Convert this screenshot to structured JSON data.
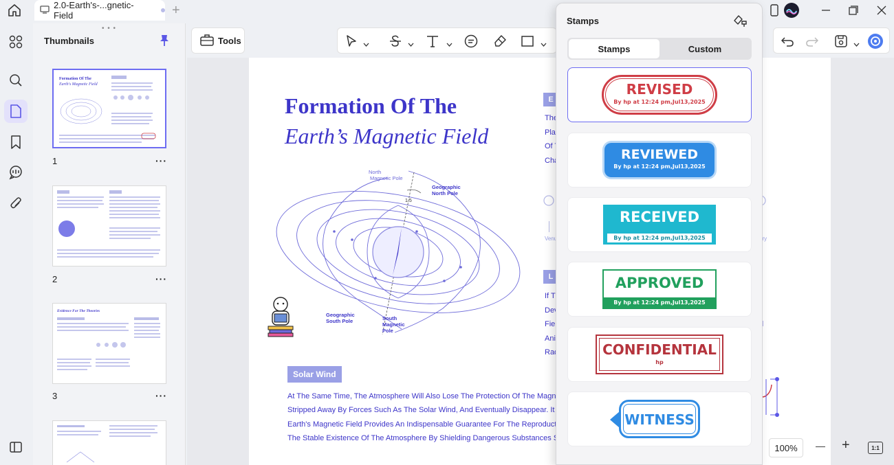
{
  "titlebar": {
    "tab_title": "2.0-Earth's-...gnetic-Field",
    "new_tab": "+"
  },
  "thumbnails": {
    "title": "Thumbnails",
    "pages": [
      {
        "number": "1",
        "more": "···"
      },
      {
        "number": "2",
        "more": "···"
      },
      {
        "number": "3",
        "more": "···"
      }
    ]
  },
  "toolbar": {
    "tools_label": "Tools"
  },
  "document": {
    "title_line1": "Formation Of The",
    "title_line2": "Earth’s Magnetic Field",
    "diagram": {
      "north_magnetic": [
        "North",
        "Magnetic Pole"
      ],
      "geo_north": [
        "Geographic",
        "North Pole"
      ],
      "angle": "1.5",
      "geo_south": [
        "Geographic",
        "South Pole"
      ],
      "south_magnetic": [
        "South",
        "Magnetic",
        "Pole"
      ]
    },
    "solar_wind_badge": "Solar Wind",
    "body_lines": [
      "At The Same Time, The Atmosphere Will Also Lose The Protection Of The Magnetic Field A",
      "Stripped Away By Forces Such As The Solar Wind, And Eventually Disappear. It Can Be Sa",
      "Earth's Magnetic Field Provides An Indispensable Guarantee For The Reproduction Of Life O",
      "The Stable Existence Of The Atmosphere By Shielding Dangerous Substances Such As Sol"
    ],
    "side_badge1": "E",
    "side_lines1": [
      "The",
      "Play",
      "Of T",
      "Cha"
    ],
    "side_label_left": "Venu",
    "side_label_right": "ury",
    "side_badge2": "L",
    "side_lines2": [
      "If T",
      "Dev",
      "Fiel",
      "Ani",
      "Rad"
    ],
    "right_peek": [
      "z",
      "d"
    ]
  },
  "zoom": {
    "value": "100%",
    "minus": "—",
    "plus": "+",
    "fit": "1:1"
  },
  "stamps_panel": {
    "title": "Stamps",
    "tabs": {
      "stamps": "Stamps",
      "custom": "Custom"
    },
    "items": [
      {
        "label": "REVISED",
        "sub": "By hp at 12:24 pm,Jul13,2025"
      },
      {
        "label": "REVIEWED",
        "sub": "By hp at 12:24 pm,Jul13,2025"
      },
      {
        "label": "RECEIVED",
        "sub": "By hp at 12:24 pm,Jul13,2025"
      },
      {
        "label": "APPROVED",
        "sub": "By hp at 12:24 pm,Jul13,2025"
      },
      {
        "label": "CONFIDENTIAL",
        "sub": "hp"
      },
      {
        "label": "WITNESS",
        "sub": ""
      }
    ]
  },
  "colors": {
    "accent": "#6d6cf2",
    "doc_blue": "#3d35c9",
    "revised": "#cf3d46",
    "reviewed": "#2f8be3",
    "received": "#1fb8cf",
    "approved": "#21a05d",
    "confidential": "#b5343d"
  },
  "icons": [
    "home-icon",
    "document-tab-icon",
    "minimize-icon",
    "maximize-icon",
    "close-icon",
    "grid-icon",
    "search-icon",
    "pages-icon",
    "bookmark-icon",
    "comment-icon",
    "attachment-icon",
    "sidebar-toggle-icon",
    "pin-icon",
    "toolbox-icon",
    "select-arrow-icon",
    "strikethrough-icon",
    "text-icon",
    "comment-bubble-icon",
    "highlighter-icon",
    "rectangle-icon",
    "undo-icon",
    "redo-icon",
    "save-icon",
    "ai-assistant-icon",
    "stamp-settings-icon",
    "fit-page-icon"
  ]
}
